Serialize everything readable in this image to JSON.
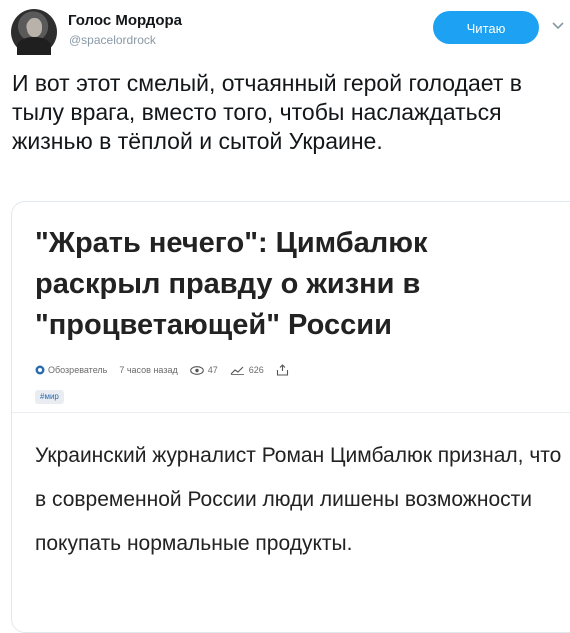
{
  "author": {
    "display_name": "Голос Мордора",
    "screen_name": "@spacelordrock"
  },
  "follow_button": {
    "label": "Читаю"
  },
  "tweet": {
    "text": "И вот этот смелый, отчаянный герой голодает в тылу врага, вместо того, чтобы наслаждаться жизнью в тёплой и сытой Украине."
  },
  "card": {
    "headline": "\"Жрать нечего\": Цимбалюк раскрыл правду о жизни в \"процветающей\" России",
    "meta": {
      "source": "Обозреватель",
      "time": "7 часов назад",
      "views": "47",
      "trend": "626"
    },
    "tag": "#мир",
    "lead": "Украинский журналист Роман Цимбалюк признал, что в современной России люди лишены возможности покупать нормальные продукты."
  },
  "colors": {
    "accent": "#1da1f2",
    "name": "#14171a",
    "muted": "#8899a6",
    "tag_text": "#2a6bb0"
  },
  "icons": [
    "avatar",
    "chevron-down-icon",
    "source-logo-icon",
    "eye-icon",
    "trend-icon",
    "share-icon"
  ]
}
